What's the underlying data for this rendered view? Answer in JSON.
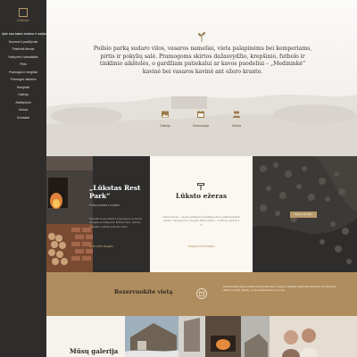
{
  "brand": {
    "name": "Lūkstas"
  },
  "sidebar": {
    "items": [
      {
        "label": "Apie mus kaimo turizmo ir sodyba kaime"
      },
      {
        "label": "Nuomos ir pasiūlymai"
      },
      {
        "label": "Pasirinkti dienas"
      },
      {
        "label": "Nakvynė ir laisvalaikis"
      },
      {
        "label": "Pirtis"
      },
      {
        "label": "Pramogos ir renginiai"
      },
      {
        "label": "Pramogos vaikams"
      },
      {
        "label": "Renginiai"
      },
      {
        "label": "Galerija"
      },
      {
        "label": "Atsiliepimai"
      },
      {
        "label": "Kainos"
      },
      {
        "label": "Kontaktai"
      }
    ]
  },
  "hero": {
    "text": "Poilsio parką sudaro vilos, vasaros nameliai, vieta palapinėms bei kemperiams, pirtis ir pokylių salė. Pramogoms skirtos dažasvydžio, krepšinio, futbolo ir tinklinio aikštelės, o gardžiam patiekalui ar kavos puodeliui – „Medininkė“ kavinė bei vasaros kavinė ant ežero kranto.",
    "features": [
      {
        "label": "Galerija",
        "icon": "gallery-icon"
      },
      {
        "label": "Rezervacija",
        "icon": "calendar-icon"
      },
      {
        "label": "Kainos",
        "icon": "people-icon"
      }
    ]
  },
  "cards": {
    "rest": {
      "title": "„Lūkstas Rest Park“",
      "subtitle": "Poilsio parkas ir sodyba",
      "description": "Nuostabi vieta poilsiui ir pramogoms su šeima, draugais ar kolegomis. Erdvios vilos, vasaros nameliai ir pokylių salė prie ežero.",
      "link": "Sužinokite daugiau"
    },
    "lake": {
      "title": "Lūksto ežeras",
      "description": "Lūksto ežeras – vienas gražiausių Žemaitijos ežerų, puikiai tinkantis poilsiui, maudynėms ir žvejybai. Ežero plotas – 1 020 ha, gylis iki 4 m.",
      "link": "Daugiau informacijos"
    },
    "map": {
      "button": "Kaip mus rasti"
    }
  },
  "reservation": {
    "title": "Rezervuokite vietą",
    "description": "Rezervuokite vilą ar poilsio namelį internetu. Greitai ir patogiai pasirinkite atvykimo bei išvykimo datas ir svečių skaičių, o mes susisieksime su jumis."
  },
  "gallery": {
    "title": "Mūsų galerija"
  }
}
